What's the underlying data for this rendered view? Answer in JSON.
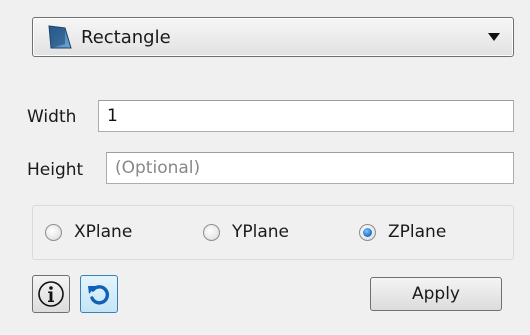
{
  "shape_selector": {
    "selected": "Rectangle",
    "icon": "rectangle-shape-icon"
  },
  "fields": {
    "width": {
      "label": "Width",
      "value": "1"
    },
    "height": {
      "label": "Height",
      "placeholder": "(Optional)"
    }
  },
  "plane_options": [
    {
      "label": "XPlane",
      "checked": false
    },
    {
      "label": "YPlane",
      "checked": false
    },
    {
      "label": "ZPlane",
      "checked": true
    }
  ],
  "buttons": {
    "info_icon": "info-icon",
    "reset_icon": "undo-icon",
    "apply": "Apply"
  },
  "colors": {
    "accent": "#3c7fb1",
    "radio_checked": "#2a7fd4"
  }
}
